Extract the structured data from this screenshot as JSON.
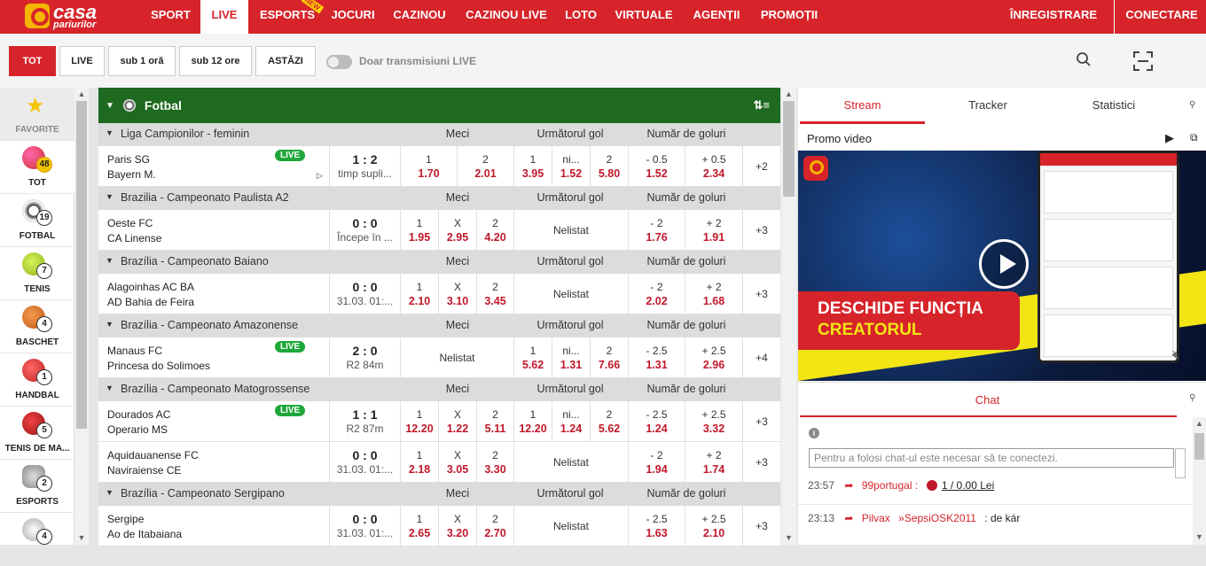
{
  "brand": {
    "line1": "casa",
    "line2": "pariurilor"
  },
  "nav": {
    "items": [
      "SPORT",
      "LIVE",
      "ESPORTS",
      "JOCURI",
      "CAZINOU",
      "CAZINOU LIVE",
      "LOTO",
      "VIRTUALE",
      "AGENȚII",
      "PROMOȚII"
    ],
    "new_badge": "NEW",
    "register": "ÎNREGISTRARE",
    "login": "CONECTARE"
  },
  "filters": {
    "buttons": [
      "TOT",
      "LIVE",
      "sub 1 oră",
      "sub 12 ore",
      "ASTĂZI"
    ],
    "toggle_label": "Doar transmisiuni LIVE"
  },
  "sidebar": {
    "items": [
      {
        "label": "FAVORITE",
        "count": ""
      },
      {
        "label": "TOT",
        "count": "48"
      },
      {
        "label": "FOTBAL",
        "count": "19"
      },
      {
        "label": "TENIS",
        "count": "7"
      },
      {
        "label": "BASCHET",
        "count": "4"
      },
      {
        "label": "HANDBAL",
        "count": "1"
      },
      {
        "label": "TENIS DE MA...",
        "count": "5"
      },
      {
        "label": "ESPORTS",
        "count": "2"
      },
      {
        "label": "",
        "count": "4"
      }
    ]
  },
  "sport": {
    "title": "Fotbal"
  },
  "headers": {
    "meci": "Meci",
    "urm": "Următorul gol",
    "nr": "Număr de goluri"
  },
  "leagues": [
    {
      "name": "Liga Campionilor - feminin"
    },
    {
      "name": "Brazilia - Campeonato Paulista A2"
    },
    {
      "name": "Brazília - Campeonato Baiano"
    },
    {
      "name": "Brazília - Campeonato Amazonense"
    },
    {
      "name": "Brazília - Campeonato Matogrossense"
    },
    {
      "name": "Brazília - Campeonato Sergipano"
    }
  ],
  "matches": [
    {
      "home": "Paris SG",
      "away": "Bayern M.",
      "live": "LIVE",
      "score": "1 : 2",
      "time": "timp supli...",
      "m1n": "1",
      "m1v": "1.70",
      "m2n": "2",
      "m2v": "2.01",
      "u1n": "1",
      "u1v": "3.95",
      "u2n": "ni...",
      "u2v": "1.52",
      "u3n": "2",
      "u3v": "5.80",
      "g1n": "- 0.5",
      "g1v": "1.52",
      "g2n": "+ 0.5",
      "g2v": "2.34",
      "more": "+2"
    },
    {
      "home": "Oeste FC",
      "away": "CA Linense",
      "score": "0 : 0",
      "time": "Începe în ...",
      "m1n": "1",
      "m1v": "1.95",
      "mxn": "X",
      "mxv": "2.95",
      "m2n": "2",
      "m2v": "4.20",
      "nelistat": "Nelistat",
      "g1n": "- 2",
      "g1v": "1.76",
      "g2n": "+ 2",
      "g2v": "1.91",
      "more": "+3"
    },
    {
      "home": "Alagoinhas AC BA",
      "away": "AD Bahia de Feira",
      "score": "0 : 0",
      "time": "31.03. 01:...",
      "m1n": "1",
      "m1v": "2.10",
      "mxn": "X",
      "mxv": "3.10",
      "m2n": "2",
      "m2v": "3.45",
      "nelistat": "Nelistat",
      "g1n": "- 2",
      "g1v": "2.02",
      "g2n": "+ 2",
      "g2v": "1.68",
      "more": "+3"
    },
    {
      "home": "Manaus FC",
      "away": "Princesa do Solimoes",
      "live": "LIVE",
      "score": "2 : 0",
      "time": "R2 84m",
      "nelistat": "Nelistat",
      "u1n": "1",
      "u1v": "5.62",
      "u2n": "ni...",
      "u2v": "1.31",
      "u3n": "2",
      "u3v": "7.66",
      "g1n": "- 2.5",
      "g1v": "1.31",
      "g2n": "+ 2.5",
      "g2v": "2.96",
      "more": "+4"
    },
    {
      "home": "Dourados AC",
      "away": "Operario MS",
      "live": "LIVE",
      "score": "1 : 1",
      "time": "R2 87m",
      "m1n": "1",
      "m1v": "12.20",
      "mxn": "X",
      "mxv": "1.22",
      "m2n": "2",
      "m2v": "5.11",
      "u1n": "1",
      "u1v": "12.20",
      "u2n": "ni...",
      "u2v": "1.24",
      "u3n": "2",
      "u3v": "5.62",
      "g1n": "- 2.5",
      "g1v": "1.24",
      "g2n": "+ 2.5",
      "g2v": "3.32",
      "more": "+3"
    },
    {
      "home": "Aquidauanense FC",
      "away": "Naviraiense CE",
      "score": "0 : 0",
      "time": "31.03. 01:...",
      "m1n": "1",
      "m1v": "2.18",
      "mxn": "X",
      "mxv": "3.05",
      "m2n": "2",
      "m2v": "3.30",
      "nelistat": "Nelistat",
      "g1n": "- 2",
      "g1v": "1.94",
      "g2n": "+ 2",
      "g2v": "1.74",
      "more": "+3"
    },
    {
      "home": "Sergipe",
      "away": "Ao de Itabaiana",
      "score": "0 : 0",
      "time": "31.03. 01:...",
      "m1n": "1",
      "m1v": "2.65",
      "mxn": "X",
      "mxv": "3.20",
      "m2n": "2",
      "m2v": "2.70",
      "nelistat": "Nelistat",
      "g1n": "- 2.5",
      "g1v": "1.63",
      "g2n": "+ 2.5",
      "g2v": "2.10",
      "more": "+3"
    }
  ],
  "right": {
    "tabs": [
      "Stream",
      "Tracker",
      "Statistici"
    ],
    "promo": "Promo video",
    "video_line1": "DESCHIDE FUNCȚIA",
    "video_line2": "CREATORUL",
    "chat_title": "Chat",
    "chat_placeholder": "Pentru a folosi chat-ul este necesar să te conectezi.",
    "messages": [
      {
        "time": "23:57",
        "user": "99portugal :",
        "tip": "1 / 0.00 Lei"
      },
      {
        "time": "23:13",
        "user": "Pilvax",
        "rec": "»SepsiOSK2011",
        "text": ": de kár"
      }
    ]
  },
  "colors": {
    "brand": "#d6242a",
    "sport": "#1e6a20",
    "odds": "#c0182a",
    "live": "#1ea73a"
  }
}
